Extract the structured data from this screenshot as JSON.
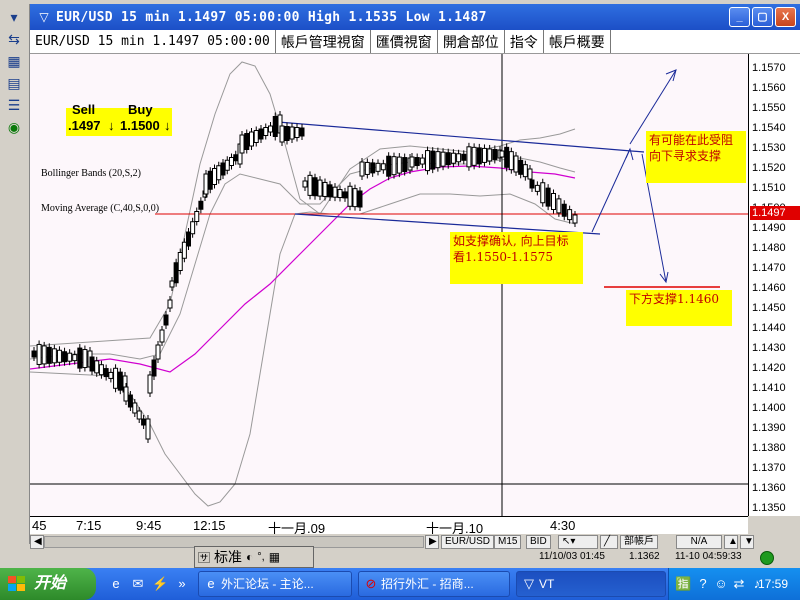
{
  "window": {
    "title": "EUR/USD 15 min 1.1497 05:00:00 High 1.1535 Low 1.1487",
    "minimize": "_",
    "maximize": "▢",
    "close": "X"
  },
  "tabs": [
    "EUR/USD 15 min 1.1497 05:00:00",
    "帳戶管理視窗",
    "匯價視窗",
    "開倉部位",
    "指令",
    "帳戶概要"
  ],
  "quote": {
    "sell_label": "Sell",
    "buy_label": "Buy",
    "sell": ".1497",
    "buy": "1.1500",
    "sell_arrow": "↓",
    "buy_arrow": "↓"
  },
  "indicators": {
    "bollinger": "Bollinger Bands (20,S,2)",
    "moving_average": "Moving Average (C,40,S,0,0)"
  },
  "annotations": {
    "resistance": "有可能在此受阻向下寻求支撑",
    "confirm": "如支撑确认, 向上目标看1.1550-1.1575",
    "support": "下方支撑1.1460"
  },
  "price_axis": {
    "labels": [
      "1.1570",
      "1.1560",
      "1.1550",
      "1.1540",
      "1.1530",
      "1.1520",
      "1.1510",
      "1.1500",
      "1.1490",
      "1.1480",
      "1.1470",
      "1.1460",
      "1.1450",
      "1.1440",
      "1.1430",
      "1.1420",
      "1.1410",
      "1.1400",
      "1.1390",
      "1.1380",
      "1.1370",
      "1.1360",
      "1.1350"
    ],
    "current": "1.1497"
  },
  "time_axis": {
    "labels": [
      "45",
      "7:15",
      "9:45",
      "12:15",
      "十一月.09",
      "十一月.10",
      "4:30"
    ]
  },
  "bottom_bar": {
    "pair": "EUR/USD",
    "period": "M15",
    "side": "BID",
    "mode": "部帳戶",
    "na": "N/A"
  },
  "status_bar": {
    "datetime": "11/10/03 01:45",
    "price": "1.1362",
    "server_time": "11-10 04:59:33"
  },
  "ime": {
    "label": "标准"
  },
  "taskbar": {
    "start": "开始",
    "tasks": [
      "外汇论坛 - 主论...",
      "招行外汇 - 招商...",
      "VT"
    ],
    "clock": "17:59"
  },
  "colors": {
    "bands": "#999999",
    "ma": "#d000d0",
    "support_line": "#e00000",
    "trend": "#1a2a99",
    "current_price": "#e00000"
  }
}
